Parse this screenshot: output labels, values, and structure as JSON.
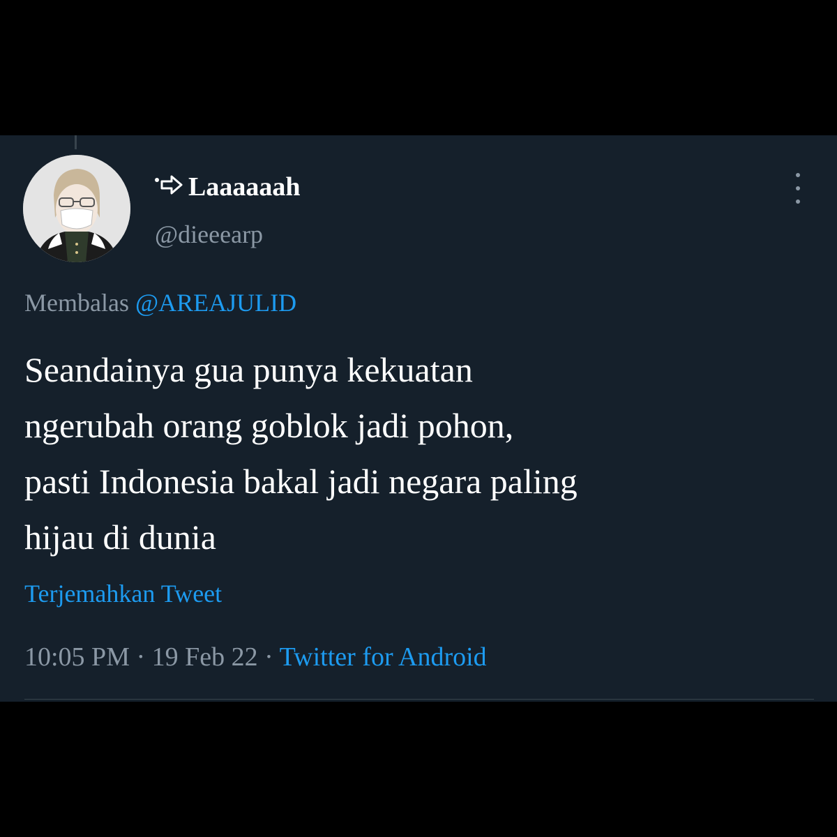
{
  "tweet": {
    "author": {
      "display_name": "Laaaaaah",
      "name_prefix_icon": "arrow-right-icon",
      "handle": "@dieeearp"
    },
    "reply": {
      "prefix": "Membalas",
      "mention": "@AREAJULID"
    },
    "text_lines": [
      "Seandainya gua punya kekuatan",
      "ngerubah orang goblok jadi pohon,",
      "pasti Indonesia bakal jadi negara paling",
      "hijau di dunia"
    ],
    "translate_label": "Terjemahkan Tweet",
    "meta": {
      "time": "10:05 PM",
      "separator": "·",
      "date": "19 Feb 22",
      "source": "Twitter for Android"
    },
    "more_icon": "more-vertical-icon"
  },
  "colors": {
    "background": "#15202b",
    "outer": "#000000",
    "text_primary": "#ffffff",
    "text_secondary": "#8b98a5",
    "accent": "#1d9bf0",
    "divider": "#38444d"
  }
}
